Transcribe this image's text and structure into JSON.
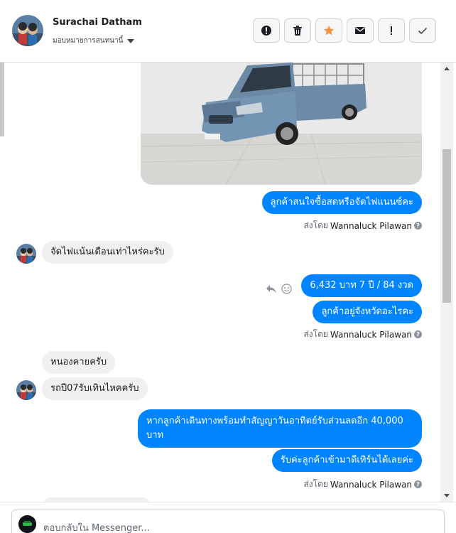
{
  "header": {
    "contact_name": "Surachai Datham",
    "assign_label": "มอบหมายการสนทนานี้"
  },
  "actions": [
    {
      "name": "spam-button",
      "icon": "alert-circle-icon"
    },
    {
      "name": "delete-button",
      "icon": "trash-icon"
    },
    {
      "name": "star-button",
      "icon": "star-icon",
      "color": "#f7923b"
    },
    {
      "name": "mark-unread-button",
      "icon": "envelope-icon"
    },
    {
      "name": "follow-up-button",
      "icon": "exclamation-icon"
    },
    {
      "name": "done-button",
      "icon": "checkmark-icon"
    }
  ],
  "thread": {
    "sent_by_prefix": "ส่งโดย",
    "agent_name": "Wannaluck Pilawan",
    "messages": [
      {
        "from": "page",
        "text": "ลูกค้าสนใจซื้อสดหรือจัดไฟแนนซ์คะ"
      },
      {
        "from": "customer",
        "text": "จัดไฟแน้นเดือนเท่าไหร่คะรับ"
      },
      {
        "from": "page",
        "text": "6,432 บาท  7 ปี / 84 งวด"
      },
      {
        "from": "page",
        "text": "ลูกค้าอยู่จังหวัดอะไรคะ"
      },
      {
        "from": "customer",
        "text": "หนองคายครับ"
      },
      {
        "from": "customer",
        "text": "รถปี07รับเทินไหคครับ"
      },
      {
        "from": "page",
        "text": "หากลูกค้าเดินทางพร้อมทำสัญญาวันอาทิตย์รับส่วนลดอีก 40,000"
      },
      {
        "from": "page",
        "text": "บาท"
      },
      {
        "from": "page",
        "text": "รับค่ะลูกค้าเข้ามาดีเทิร์นได้เลยค่ะ"
      }
    ]
  },
  "composer": {
    "placeholder": "ตอบกลับใน Messenger..."
  },
  "colors": {
    "outgoing_bubble": "#0084ff",
    "incoming_bubble": "#f0f0f0"
  }
}
